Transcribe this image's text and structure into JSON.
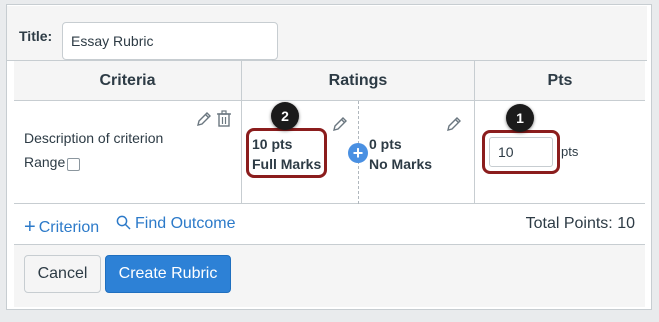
{
  "title_row": {
    "label": "Title:",
    "value": "Essay Rubric"
  },
  "headers": {
    "criteria": "Criteria",
    "ratings": "Ratings",
    "pts": "Pts"
  },
  "criterion": {
    "description": "Description of criterion",
    "range_label": "Range",
    "range_checked": false
  },
  "ratings": [
    {
      "points": "10 pts",
      "description": "Full Marks"
    },
    {
      "points": "0 pts",
      "description": "No Marks"
    }
  ],
  "points": {
    "value": "10",
    "unit": "pts"
  },
  "callouts": {
    "ratings": "2",
    "points": "1"
  },
  "footer": {
    "add_criterion": "Criterion",
    "find_outcome": "Find Outcome",
    "total_points": "Total Points: 10"
  },
  "actions": {
    "cancel": "Cancel",
    "create": "Create Rubric"
  },
  "icons": [
    "pencil-icon",
    "trash-icon",
    "plus-icon",
    "search-icon",
    "add-rating-icon"
  ],
  "colors": {
    "link": "#2c7ac9",
    "primary_button": "#2d81d6",
    "highlight": "#8b1d1d",
    "badge": "#1b1b1b"
  }
}
